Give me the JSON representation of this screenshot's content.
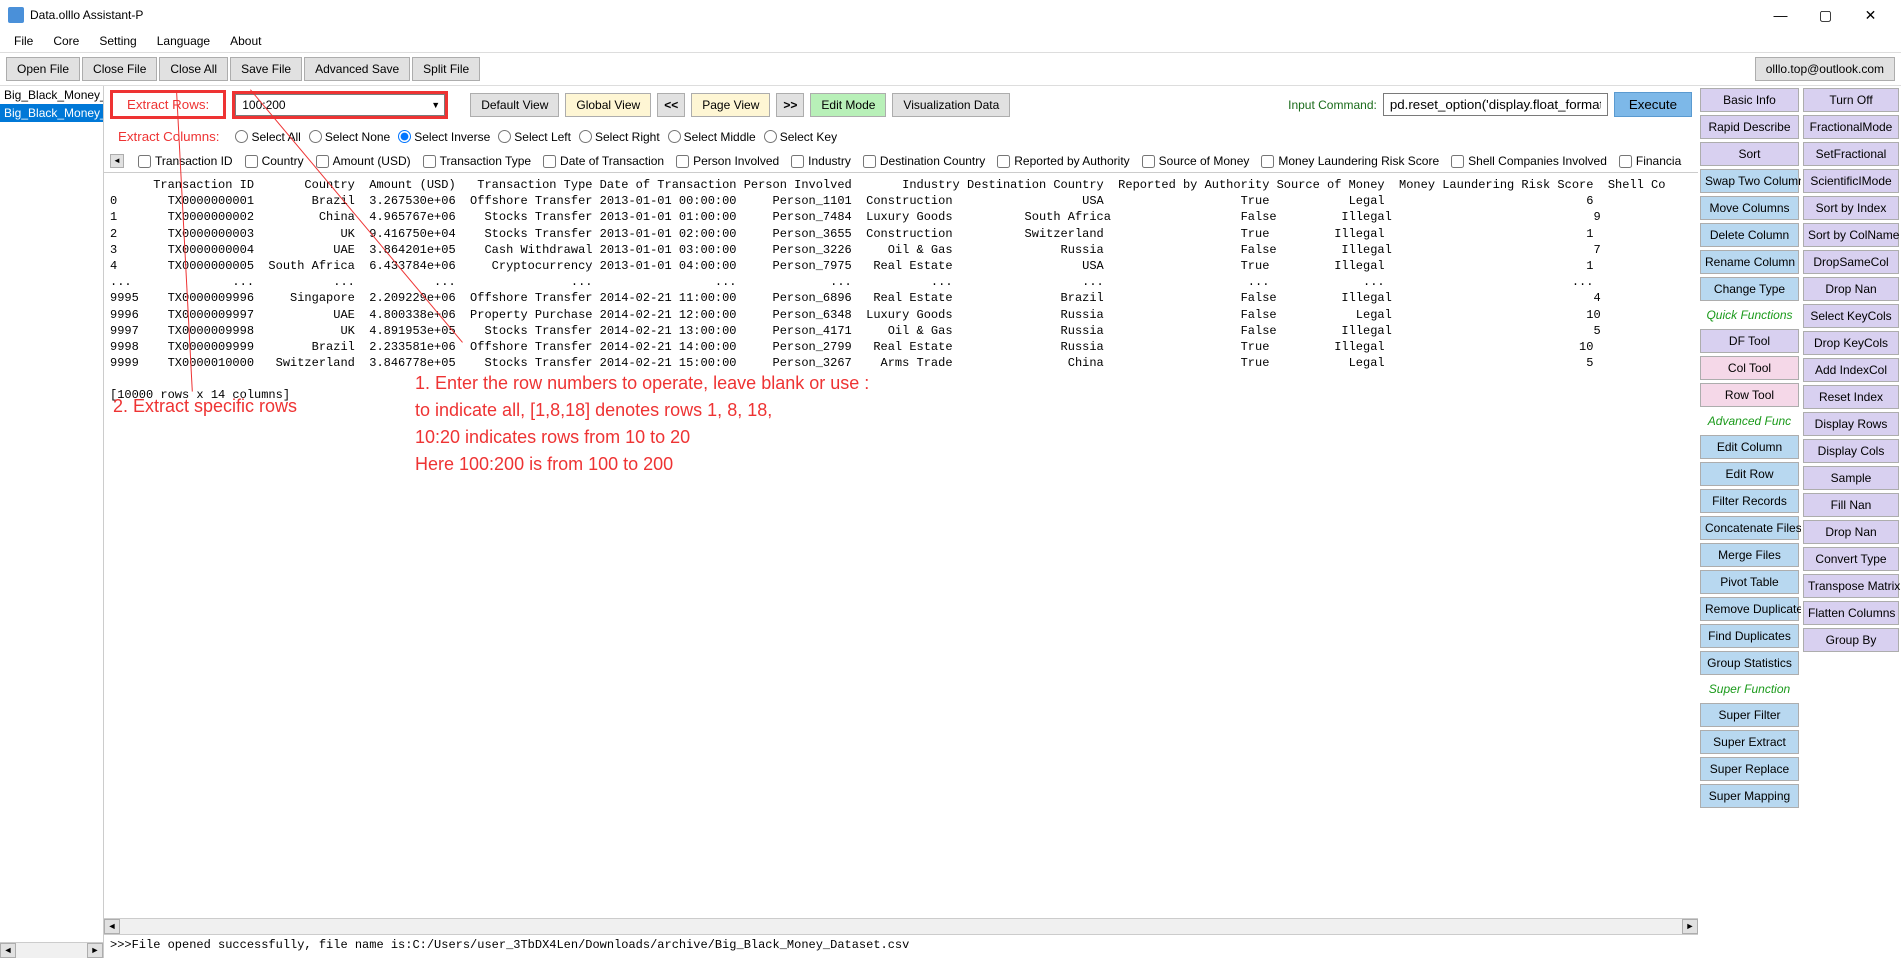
{
  "window": {
    "title": "Data.olllo Assistant-P"
  },
  "menu": [
    "File",
    "Core",
    "Setting",
    "Language",
    "About"
  ],
  "toolbar": [
    "Open File",
    "Close File",
    "Close All",
    "Save File",
    "Advanced Save",
    "Split File"
  ],
  "email": "olllo.top@outlook.com",
  "sidebar": {
    "items": [
      "Big_Black_Money_Data",
      "Big_Black_Money_Data"
    ],
    "active_index": 1
  },
  "controls": {
    "extract_rows": "Extract Rows:",
    "extract_cols": "Extract Columns:",
    "row_input_value": "100:200",
    "default_view": "Default View",
    "global_view": "Global View",
    "page_view": "Page View",
    "back": "<<",
    "forward": ">>",
    "edit_mode": "Edit Mode",
    "vis_data": "Visualization Data",
    "input_cmd_label": "Input Command:",
    "input_cmd_value": "pd.reset_option('display.float_format')",
    "execute": "Execute"
  },
  "radios": [
    "Select All",
    "Select None",
    "Select Inverse",
    "Select Left",
    "Select Right",
    "Select Middle",
    "Select Key"
  ],
  "radio_selected": 2,
  "checkboxes": [
    "Transaction ID",
    "Country",
    "Amount (USD)",
    "Transaction Type",
    "Date of Transaction",
    "Person Involved",
    "Industry",
    "Destination Country",
    "Reported by Authority",
    "Source of Money",
    "Money Laundering Risk Score",
    "Shell Companies Involved",
    "Financia"
  ],
  "data_headers": "      Transaction ID       Country  Amount (USD)   Transaction Type Date of Transaction Person Involved       Industry Destination Country  Reported by Authority Source of Money  Money Laundering Risk Score  Shell Co",
  "data_rows": [
    "0       TX0000000001        Brazil  3.267530e+06  Offshore Transfer 2013-01-01 00:00:00     Person_1101  Construction                  USA                   True           Legal                            6",
    "1       TX0000000002         China  4.965767e+06    Stocks Transfer 2013-01-01 01:00:00     Person_7484  Luxury Goods          South Africa                  False         Illegal                            9",
    "2       TX0000000003            UK  9.416750e+04    Stocks Transfer 2013-01-01 02:00:00     Person_3655  Construction          Switzerland                   True         Illegal                            1",
    "3       TX0000000004           UAE  3.864201e+05    Cash Withdrawal 2013-01-01 03:00:00     Person_3226     Oil & Gas               Russia                   False         Illegal                            7",
    "4       TX0000000005  South Africa  6.433784e+06     Cryptocurrency 2013-01-01 04:00:00     Person_7975   Real Estate                  USA                   True         Illegal                            1",
    "...              ...           ...           ...                ...                 ...             ...           ...                  ...                    ...             ...                          ...",
    "9995    TX0000009996     Singapore  2.209229e+06  Offshore Transfer 2014-02-21 11:00:00     Person_6896   Real Estate               Brazil                   False         Illegal                            4",
    "9996    TX0000009997           UAE  4.800338e+06  Property Purchase 2014-02-21 12:00:00     Person_6348  Luxury Goods               Russia                   False           Legal                           10",
    "9997    TX0000009998            UK  4.891953e+05    Stocks Transfer 2014-02-21 13:00:00     Person_4171     Oil & Gas               Russia                   False         Illegal                            5",
    "9998    TX0000009999        Brazil  2.233581e+06  Offshore Transfer 2014-02-21 14:00:00     Person_2799   Real Estate               Russia                   True         Illegal                           10",
    "9999    TX0000010000   Switzerland  3.846778e+05    Stocks Transfer 2014-02-21 15:00:00     Person_3267    Arms Trade                China                   True           Legal                            5"
  ],
  "data_footer": "[10000 rows x 14 columns]",
  "log_line": ">>>File opened successfully, file name is:C:/Users/user_3TbDX4Len/Downloads/archive/Big_Black_Money_Dataset.csv",
  "right_col1": [
    {
      "label": "Basic Info",
      "cls": "rp-lav"
    },
    {
      "label": "Rapid Describe",
      "cls": "rp-lav"
    },
    {
      "label": "Sort",
      "cls": "rp-lav"
    },
    {
      "label": "Swap Two Columns",
      "cls": "rp-blue"
    },
    {
      "label": "Move Columns",
      "cls": "rp-blue"
    },
    {
      "label": "Delete Column",
      "cls": "rp-blue"
    },
    {
      "label": "Rename Column",
      "cls": "rp-blue"
    },
    {
      "label": "Change Type",
      "cls": "rp-blue"
    },
    {
      "label": "Quick Functions",
      "cls": "rp-green-head"
    },
    {
      "label": "DF Tool",
      "cls": "rp-lav"
    },
    {
      "label": "Col Tool",
      "cls": "rp-pink"
    },
    {
      "label": "Row Tool",
      "cls": "rp-pink"
    },
    {
      "label": "Advanced Func",
      "cls": "rp-green-head"
    },
    {
      "label": "Edit Column",
      "cls": "rp-blue"
    },
    {
      "label": "Edit Row",
      "cls": "rp-blue"
    },
    {
      "label": "Filter Records",
      "cls": "rp-blue"
    },
    {
      "label": "Concatenate Files",
      "cls": "rp-blue"
    },
    {
      "label": "Merge Files",
      "cls": "rp-blue"
    },
    {
      "label": "Pivot Table",
      "cls": "rp-blue"
    },
    {
      "label": "Remove Duplicates",
      "cls": "rp-blue"
    },
    {
      "label": "Find Duplicates",
      "cls": "rp-blue"
    },
    {
      "label": "Group Statistics",
      "cls": "rp-blue"
    },
    {
      "label": "Super Function",
      "cls": "rp-green-head"
    },
    {
      "label": "Super Filter",
      "cls": "rp-blue"
    },
    {
      "label": "Super Extract",
      "cls": "rp-blue"
    },
    {
      "label": "Super Replace",
      "cls": "rp-blue"
    },
    {
      "label": "Super Mapping",
      "cls": "rp-blue"
    }
  ],
  "right_col2": [
    {
      "label": "Turn Off",
      "cls": "rp-lav"
    },
    {
      "label": "FractionalMode",
      "cls": "rp-lav"
    },
    {
      "label": "SetFractional",
      "cls": "rp-lav"
    },
    {
      "label": "ScientificIMode",
      "cls": "rp-lav"
    },
    {
      "label": "Sort by Index",
      "cls": "rp-lav"
    },
    {
      "label": "Sort by ColName",
      "cls": "rp-lav"
    },
    {
      "label": "DropSameCol",
      "cls": "rp-lav"
    },
    {
      "label": "Drop Nan",
      "cls": "rp-lav"
    },
    {
      "label": "Select KeyCols",
      "cls": "rp-lav"
    },
    {
      "label": "Drop KeyCols",
      "cls": "rp-lav"
    },
    {
      "label": "Add IndexCol",
      "cls": "rp-lav"
    },
    {
      "label": "Reset Index",
      "cls": "rp-lav"
    },
    {
      "label": "Display Rows",
      "cls": "rp-lav"
    },
    {
      "label": "Display Cols",
      "cls": "rp-lav"
    },
    {
      "label": "Sample",
      "cls": "rp-lav"
    },
    {
      "label": "Fill Nan",
      "cls": "rp-lav"
    },
    {
      "label": "Drop Nan",
      "cls": "rp-lav"
    },
    {
      "label": "Convert Type",
      "cls": "rp-lav"
    },
    {
      "label": "Transpose Matrix",
      "cls": "rp-lav"
    },
    {
      "label": "Flatten Columns",
      "cls": "rp-lav"
    },
    {
      "label": "Group By",
      "cls": "rp-lav"
    }
  ],
  "annotations": {
    "a2": "2. Extract specific rows",
    "a1_l1": "1. Enter the row numbers to operate, leave blank or use :",
    "a1_l2": "to indicate all, [1,8,18] denotes rows 1, 8, 18,",
    "a1_l3": "10:20 indicates rows from 10 to 20",
    "a1_l4": "Here 100:200 is from 100 to 200"
  }
}
